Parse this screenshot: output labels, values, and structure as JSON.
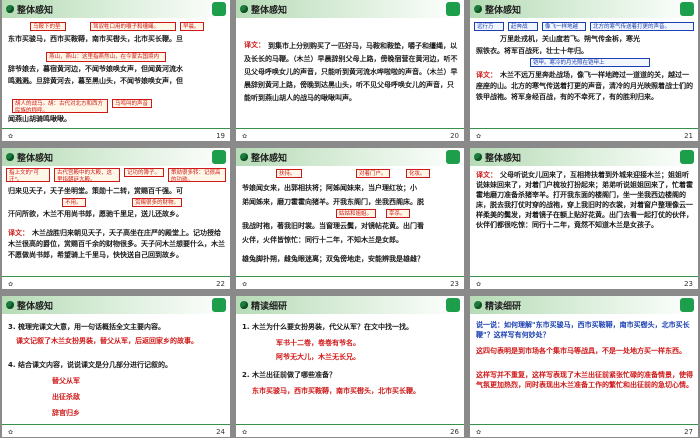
{
  "slides": [
    {
      "title": "整体感知",
      "page": "19",
      "lines": [
        "东市买骏马，西市买鞍鞯，南市买辔头，北市买长鞭。旦",
        "辞爷娘去，暮宿黄河边，不闻爷娘唤女声，但闻黄河流水",
        "鸣溅溅。旦辞黄河去，暮至黑山头，不闻爷娘唤女声，但",
        "闻燕山胡骑鸣啾啾。"
      ],
      "notes": [
        "马鞍下的垫子。",
        "驾驭牲口用的嚼子和缰绳。",
        "早晨。",
        "燕山，燕山：这里指燕然山，在今蒙古国境内",
        "胡人的战马。胡：古代对北方和西方民族的称呼。",
        "马鸣叫的声音"
      ]
    },
    {
      "title": "整体感知",
      "page": "20",
      "label": "译文：",
      "body": "到集市上分别购买了一匹好马，马鞍和鞍垫，嚼子和缰绳，以及长长的马鞭。（木兰）早晨辞别父母上路，傍晚宿营在黄河边，听不见父母呼唤女儿的声音，只能听到黄河流水哗啦啦的声音。（木兰）早晨辞别黄河上路，傍晚到达黑山头，听不见父母呼唤女儿的声音，只能听到燕山胡人的战马的啾啾叫声。"
    },
    {
      "title": "整体感知",
      "page": "21",
      "top_notes": [
        "远行万里。",
        "赶奔战场。",
        "像飞一样地越过。",
        "北方的寒气传送着打更的声音。"
      ],
      "verse1": "万里赴戎机，关山度若飞。朔气传金柝，寒光",
      "verse2": "照铁衣。将军百战死，壮士十年归。",
      "mid_note": "铠甲。寒冷的月光照在铠甲上",
      "label": "译文：",
      "body": "木兰不远万里奔赴战场，像飞一样地跨过一道道的关，越过一座座的山。北方的寒气传送着打更的声音，清冷的月光映照着战士们的铁甲战袍。将军身经百战，有的不幸死了，有的胜利归来。"
    },
    {
      "title": "整体感知",
      "page": "22",
      "notes": [
        "指上文的\"可汗\"。",
        "古代宫殿中的大殿，这里指朝廷大殿。",
        "记功的簿子。",
        "策勋很多转：记很高的功勋。",
        "赏赐很多的财物。",
        "不用。"
      ],
      "verse1": "归来见天子，天子坐明堂。策勋十二转，赏赐百千强。可",
      "verse2": "汗问所欲，木兰不用尚书郎，愿驰千里足，送儿还故乡。",
      "label": "译文：",
      "body": "木兰战胜归来朝见天子，天子高坐在庄严的殿堂上。记功授给木兰很高的爵位，赏赐百千余的财物很多。天子问木兰想要什么，木兰不愿做尚书郎，希望骑上千里马，快快送自己回到故乡。"
    },
    {
      "title": "整体感知",
      "page": "23",
      "notes": [
        "扶持。",
        "对着门户。",
        "化妆。",
        "姑姑和姐姐。",
        "宰杀。"
      ],
      "lines": [
        "爷娘闻女来，出郭相扶将；阿姊闻妹来，当户理红妆；小",
        "弟闻姊来，磨刀霍霍向猪羊。开我东阁门，坐我西阁床。脱",
        "我战时袍，著我旧时裳。当窗理云鬓，对镜帖花黄。出门看",
        "火伴，火伴皆惊忙：同行十二年，不知木兰是女郎。",
        "雄兔脚扑朔，雌兔眼迷离；双兔傍地走，安能辨我是雄雌？"
      ],
      "label": "译文：",
      "body": "父母听说女儿回来了，互相搀扶着到外城来迎接木兰；姐姐听说妹妹回来了，对着门户梳妆打扮起来；弟弟听说姐姐回来了，忙着霍霍地磨刀准备杀猪宰羊。打开我东面的楼阁门，坐一坐我西边楼阁的床，脱去我打仗时穿的战袍，穿上我旧时的衣裳，对着窗户整理像云一样柔美的鬓发，对着镜子在额上贴好花黄。出门去看一起打仗的伙伴，伙伴们都很吃惊：同行十二年，竟然不知道木兰是女孩子。"
    },
    {
      "title": "整体感知",
      "page": "24",
      "q3": "3. 梳理完课文大意，用一句话概括全文主要内容。",
      "a3": "课文记叙了木兰女扮男装，替父从军，后返回家乡的故事。",
      "q4": "4. 结合课文内容，说说课文是分几部分进行记叙的。",
      "parts": [
        "替父从军",
        "出征杀敌",
        "辞官归乡"
      ]
    },
    {
      "title": "精读细研",
      "page": "26",
      "q1": "1. 木兰为什么要女扮男装，代父从军？在文中找一找。",
      "a1": [
        "军书十二卷，卷卷有爷名。",
        "阿爷无大儿，木兰无长兄。"
      ],
      "q2": "2. 木兰出征前做了哪些准备？",
      "a2": "东市买骏马，西市买鞍鞯，南市买辔头，北市买长鞭。"
    },
    {
      "title": "精读细研",
      "page": "27",
      "q": "说一说：如何理解\"东市买骏马，西市买鞍鞯，南市买辔头，北市买长鞭\"？这样写有何妙处？",
      "a1": "这四句表明是到市场各个集市马等战具，不是一处地方买一样东西。",
      "a2": "这样写并不重复，这样写表现了木兰出征前紧张忙碌的准备情景，使得气氛更加热烈，同时表现出木兰准备工作的繁忙和出征前的急切心情。"
    }
  ]
}
